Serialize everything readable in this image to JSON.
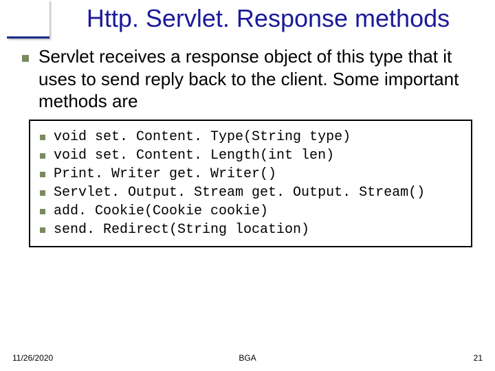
{
  "title": "Http. Servlet. Response methods",
  "intro": "Servlet receives a response object of this type that it uses to send reply back to the client. Some important methods are",
  "methods": [
    "void set. Content. Type(String type)",
    "void set. Content. Length(int len)",
    "Print. Writer get. Writer()",
    "Servlet. Output. Stream get. Output. Stream()",
    "add. Cookie(Cookie cookie)",
    "send. Redirect(String location)"
  ],
  "footer": {
    "date": "11/26/2020",
    "center": "BGA",
    "page": "21"
  }
}
